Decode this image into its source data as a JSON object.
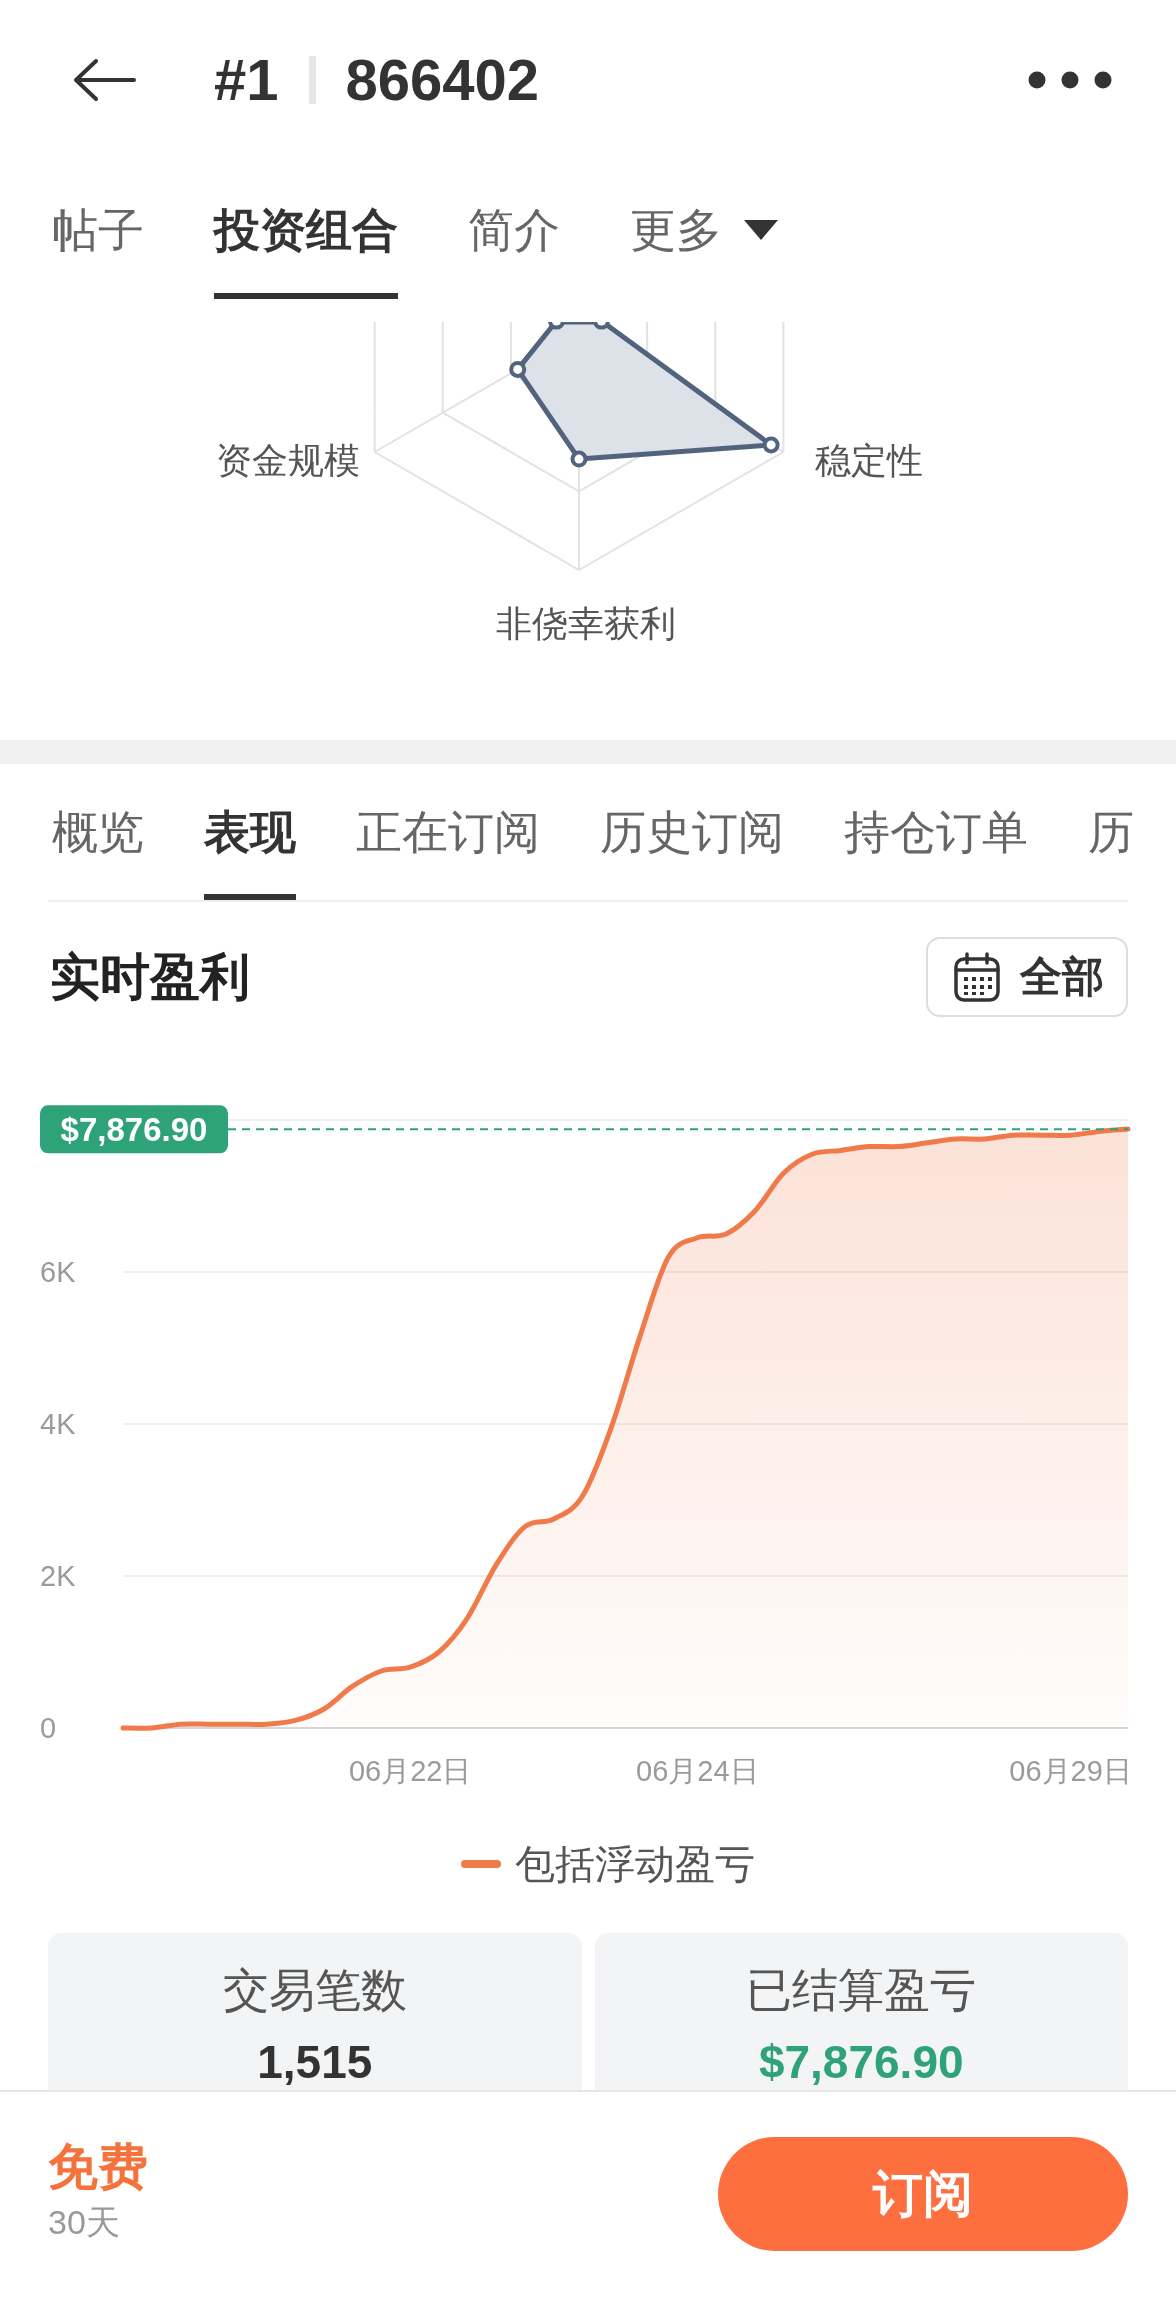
{
  "header": {
    "rank": "#1",
    "trader_id": "866402"
  },
  "profile_tabs": [
    {
      "label": "帖子",
      "selected": false,
      "kind": "plain"
    },
    {
      "label": "投资组合",
      "selected": true,
      "kind": "plain"
    },
    {
      "label": "简介",
      "selected": false,
      "kind": "plain"
    },
    {
      "label": "更多",
      "selected": false,
      "kind": "dropdown"
    }
  ],
  "radar": {
    "axes": [
      {
        "label": "资金规模"
      },
      {
        "label": "稳定性"
      },
      {
        "label": "非侥幸获利"
      }
    ]
  },
  "performance_tabs": [
    {
      "label": "概览",
      "selected": false
    },
    {
      "label": "表现",
      "selected": true
    },
    {
      "label": "正在订阅",
      "selected": false
    },
    {
      "label": "历史订阅",
      "selected": false
    },
    {
      "label": "持仓订单",
      "selected": false
    },
    {
      "label": "历",
      "selected": false
    }
  ],
  "profit_section": {
    "title": "实时盈利",
    "range_button": "全部",
    "chart_data": {
      "type": "area",
      "grid": true,
      "categories": [
        null,
        null,
        null,
        null,
        null,
        null,
        null,
        null,
        null,
        null,
        "06月22日",
        null,
        null,
        null,
        null,
        null,
        null,
        null,
        null,
        null,
        "06月24日",
        null,
        null,
        null,
        null,
        null,
        null,
        null,
        null,
        null,
        null,
        null,
        null,
        "06月29日",
        null,
        null
      ],
      "ylim": [
        0,
        8000
      ],
      "yticks": [
        {
          "value": 0,
          "label": "0"
        },
        {
          "value": 2000,
          "label": "2K"
        },
        {
          "value": 4000,
          "label": "4K"
        },
        {
          "value": 6000,
          "label": "6K"
        }
      ],
      "series": [
        {
          "name": "包括浮动盈亏",
          "color": "#f07a4a",
          "values": [
            0,
            0,
            50,
            50,
            50,
            50,
            100,
            250,
            550,
            750,
            800,
            1000,
            1450,
            2150,
            2650,
            2750,
            3050,
            3950,
            5150,
            6200,
            6450,
            6500,
            6800,
            7300,
            7550,
            7600,
            7650,
            7650,
            7700,
            7750,
            7750,
            7800,
            7800,
            7800,
            7850,
            7880
          ]
        }
      ],
      "ref_lines": [
        {
          "axis": "y",
          "value": 7876.9,
          "label": "$7,876.90",
          "color": "#2ea37a"
        }
      ]
    }
  },
  "stats": [
    {
      "label": "交易笔数",
      "value": "1,515",
      "kind": "count"
    },
    {
      "label": "已结算盈亏",
      "value": "$7,876.90",
      "kind": "profit"
    }
  ],
  "bottom_bar": {
    "price": "免费",
    "period": "30天",
    "subscribe_button": "订阅"
  }
}
